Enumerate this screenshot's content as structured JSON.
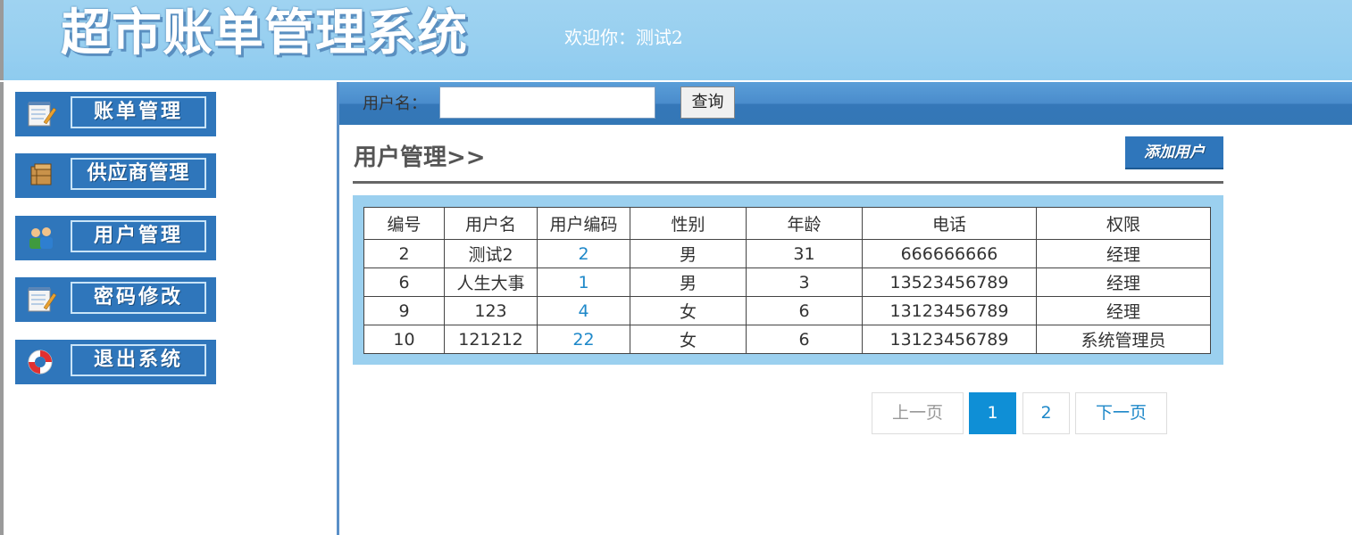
{
  "header": {
    "logo_text": "超市账单管理系统",
    "welcome": "欢迎你：测试2"
  },
  "sidebar": {
    "items": [
      {
        "label": "账单管理",
        "icon": "notepad-icon"
      },
      {
        "label": "供应商管理",
        "icon": "box-icon"
      },
      {
        "label": "用户管理",
        "icon": "users-icon"
      },
      {
        "label": "密码修改",
        "icon": "notepad-icon"
      },
      {
        "label": "退出系统",
        "icon": "lifebuoy-icon"
      }
    ]
  },
  "search": {
    "label": "用户名：",
    "value": "",
    "button": "查询"
  },
  "main": {
    "title": "用户管理>>",
    "add_button": "添加用户"
  },
  "table": {
    "headers": [
      "编号",
      "用户名",
      "用户编码",
      "性别",
      "年龄",
      "电话",
      "权限"
    ],
    "rows": [
      [
        "2",
        "测试2",
        "2",
        "男",
        "31",
        "666666666",
        "经理"
      ],
      [
        "6",
        "人生大事",
        "1",
        "男",
        "3",
        "13523456789",
        "经理"
      ],
      [
        "9",
        "123",
        "4",
        "女",
        "6",
        "13123456789",
        "经理"
      ],
      [
        "10",
        "121212",
        "22",
        "女",
        "6",
        "13123456789",
        "系统管理员"
      ]
    ]
  },
  "pagination": {
    "prev": "上一页",
    "pages": [
      "1",
      "2"
    ],
    "current": "1",
    "next": "下一页"
  },
  "colors": {
    "header_bg": "#97cff0",
    "menu_bg": "#2f76bb",
    "active_page": "#0f8fd6",
    "link": "#1e88c9"
  }
}
